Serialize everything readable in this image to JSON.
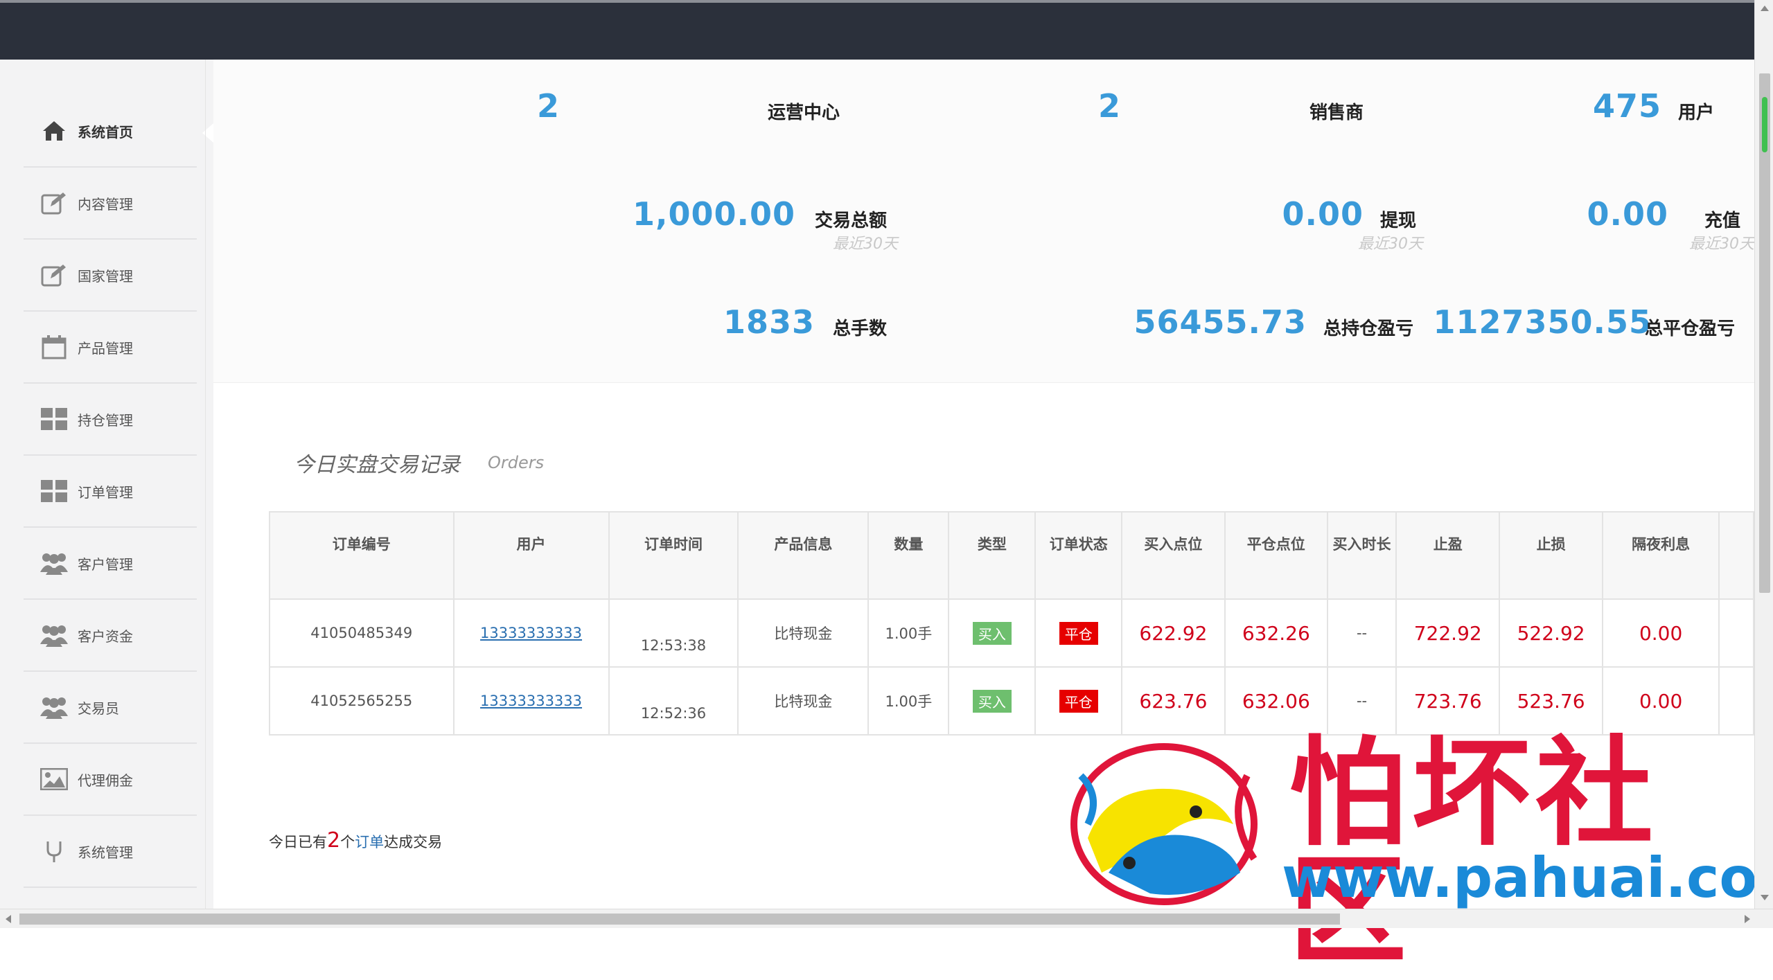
{
  "sidebar": {
    "items": [
      {
        "label": "系统首页",
        "icon": "home-icon",
        "active": true
      },
      {
        "label": "内容管理",
        "icon": "edit-icon"
      },
      {
        "label": "国家管理",
        "icon": "edit-icon"
      },
      {
        "label": "产品管理",
        "icon": "calendar-icon"
      },
      {
        "label": "持仓管理",
        "icon": "grid-icon"
      },
      {
        "label": "订单管理",
        "icon": "grid-icon"
      },
      {
        "label": "客户管理",
        "icon": "users-icon"
      },
      {
        "label": "客户资金",
        "icon": "users-icon"
      },
      {
        "label": "交易员",
        "icon": "users-icon"
      },
      {
        "label": "代理佣金",
        "icon": "image-icon"
      },
      {
        "label": "系统管理",
        "icon": "settings-icon"
      }
    ]
  },
  "stats": {
    "ops_center": {
      "value": "2",
      "label": "运营中心"
    },
    "sellers": {
      "value": "2",
      "label": "销售商"
    },
    "users": {
      "value": "475",
      "label": "用户"
    },
    "trade_total": {
      "value": "1,000.00",
      "label": "交易总额",
      "sub": "最近30天"
    },
    "withdraw": {
      "value": "0.00",
      "label": "提现",
      "sub": "最近30天"
    },
    "recharge": {
      "value": "0.00",
      "label": "充值",
      "sub": "最近30天"
    },
    "total_lots": {
      "value": "1833",
      "label": "总手数"
    },
    "holding_pl": {
      "value": "56455.73",
      "label": "总持仓盈亏"
    },
    "closed_pl": {
      "value": "1127350.55",
      "label": "总平仓盈亏"
    }
  },
  "orders": {
    "title": "今日实盘交易记录",
    "subtitle": "Orders",
    "headers": [
      "订单编号",
      "用户",
      "订单时间",
      "产品信息",
      "数量",
      "类型",
      "订单状态",
      "买入点位",
      "平仓点位",
      "买入时长",
      "止盈",
      "止损",
      "隔夜利息"
    ],
    "rows": [
      {
        "id": "41050485349",
        "user": "13333333333",
        "time": "12:53:38",
        "product": "比特现金",
        "qty": "1.00手",
        "type": "买入",
        "status": "平仓",
        "buy": "622.92",
        "close": "632.26",
        "duration": "--",
        "tp": "722.92",
        "sl": "522.92",
        "interest": "0.00"
      },
      {
        "id": "41052565255",
        "user": "13333333333",
        "time": "12:52:36",
        "product": "比特现金",
        "qty": "1.00手",
        "type": "买入",
        "status": "平仓",
        "buy": "623.76",
        "close": "632.06",
        "duration": "--",
        "tp": "723.76",
        "sl": "523.76",
        "interest": "0.00"
      }
    ],
    "summary": {
      "prefix": "今日已有",
      "count": "2",
      "unit": "个",
      "link": "订单",
      "suffix": "达成交易"
    }
  },
  "watermark": {
    "title": "怕坏社区",
    "url": "www.pahuai.com"
  },
  "colors": {
    "accent": "#3a9ad9",
    "topbar": "#2b303b",
    "red": "#d0021b"
  }
}
